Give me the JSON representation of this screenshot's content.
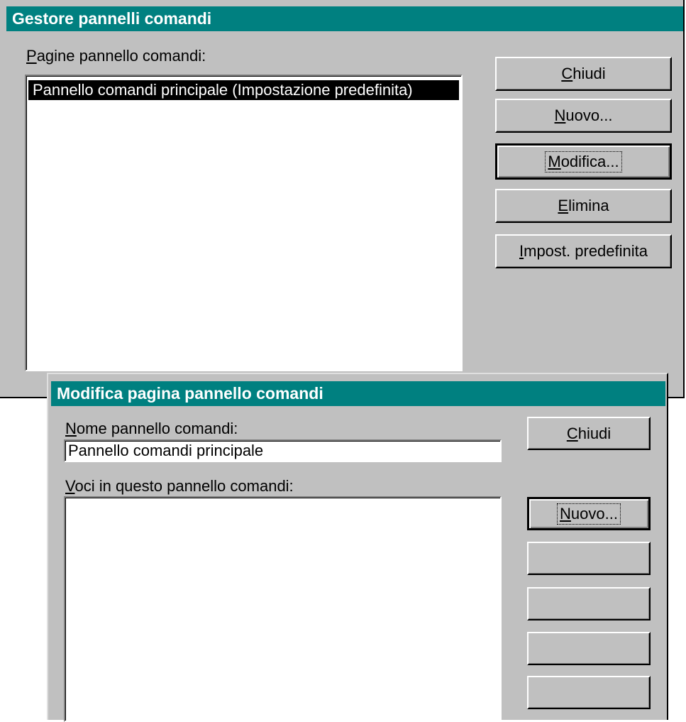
{
  "manager": {
    "title": "Gestore pannelli comandi",
    "pages_label_accel": "P",
    "pages_label_rest": "agine pannello comandi:",
    "pages": [
      {
        "label": "Pannello comandi principale (Impostazione predefinita)",
        "selected": true
      }
    ],
    "buttons": {
      "close_accel": "C",
      "close_rest": "hiudi",
      "new_accel": "N",
      "new_rest": "uovo...",
      "edit_accel": "M",
      "edit_rest": "odifica...",
      "delete_accel": "E",
      "delete_rest": "limina",
      "default_accel": "I",
      "default_rest": "mpost. predefinita"
    }
  },
  "editor": {
    "title": "Modifica pagina pannello comandi",
    "name_label_accel": "N",
    "name_label_rest": "ome pannello comandi:",
    "name_value": "Pannello comandi principale",
    "items_label_accel": "V",
    "items_label_rest": "oci in questo pannello comandi:",
    "items": [],
    "buttons": {
      "close_accel": "C",
      "close_rest": "hiudi",
      "new_accel": "N",
      "new_rest": "uovo...",
      "edit_label": "",
      "delete_label": "",
      "up_label": "",
      "down_label": ""
    }
  },
  "colors": {
    "titlebar": "#008080",
    "dialog_bg": "#c0c0c0",
    "selection": "#000000"
  }
}
